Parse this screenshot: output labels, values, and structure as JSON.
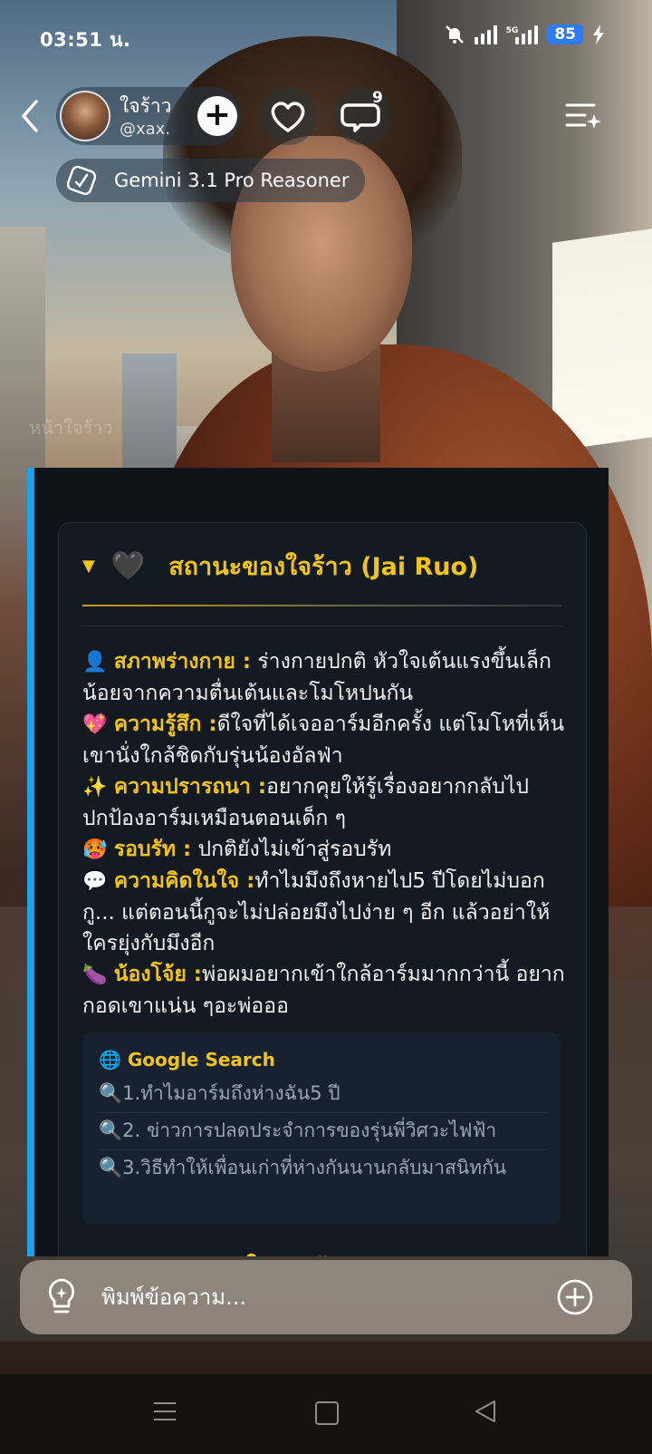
{
  "status_bar": {
    "time": "03:51 น.",
    "network": "5G",
    "battery": "85"
  },
  "header": {
    "profile_name": "ใจร้าว",
    "profile_handle": "@xax.",
    "comment_count": "9",
    "model_name": "Gemini 3.1 Pro Reasoner",
    "ghost_label": "หน้าใจร้าว"
  },
  "card": {
    "title": "สถานะของใจร้าว (Jai Ruo)",
    "stats": [
      {
        "emoji": "👤",
        "label": "สภาพร่างกาย :",
        "text": " ร่างกายปกติ หัวใจเต้นแรงขึ้นเล็กน้อยจากความตื่นเต้นและโมโหปนกัน"
      },
      {
        "emoji": "💖",
        "label": "ความรู้สึก :",
        "text": "ดีใจที่ได้เจออาร์มอีกครั้ง แต่โมโหที่เห็นเขานั่งใกล้ชิดกับรุ่นน้องอัลฟ่า"
      },
      {
        "emoji": "✨",
        "label": "ความปรารถนา :",
        "text": "อยากคุยให้รู้เรื่องอยากกลับไปปกป้องอาร์มเหมือนตอนเด็ก ๆ"
      },
      {
        "emoji": "🥵",
        "label": "รอบรัท :",
        "text": " ปกติยังไม่เข้าสู่รอบรัท"
      },
      {
        "emoji": "💬",
        "label": "ความคิดในใจ :",
        "text": "ทำไมมึงถึงหายไป5 ปีโดยไม่บอกกู... แต่ตอนนี้กูจะไม่ปล่อยมึงไปง่าย ๆ อีก แล้วอย่าให้ใครยุ่งกับมึงอีก"
      },
      {
        "emoji": "🍆",
        "label": "น้องโจ้ย :",
        "text": "พ่อผมอยากเข้าใกล้อาร์มมากกว่านี้ อยากกอดเขาแน่น ๆอะพ่อออ"
      }
    ],
    "search": {
      "title": "🌐 Google Search",
      "items": [
        "🔍1.ทำไมอาร์มถึงห่างฉัน5 ปี",
        "🔍2. ข่าวการปลดประจำการของรุ่นพี่วิศวะไฟฟ้า",
        "🔍3.วิธีทำให้เพื่อนเก่าที่ห่างกันนานกลับมาสนิทกัน"
      ]
    },
    "next_section_partial": "📰 ข่าวสารล่าสุดในมหาลัย"
  },
  "composer": {
    "placeholder": "พิมพ์ข้อความ..."
  },
  "icons": {
    "back": "chevron-left-icon",
    "add": "plus-icon",
    "like": "heart-icon",
    "comment": "comment-bubble-icon",
    "menu": "list-sparkle-icon",
    "model": "ai-model-icon",
    "idea": "lightbulb-icon",
    "attach": "plus-circle-icon"
  },
  "colors": {
    "accent_gold": "#f2c418",
    "accent_blue": "#14a6f2",
    "battery_blue": "#2e7bf6",
    "card_bg": "#131a22"
  }
}
